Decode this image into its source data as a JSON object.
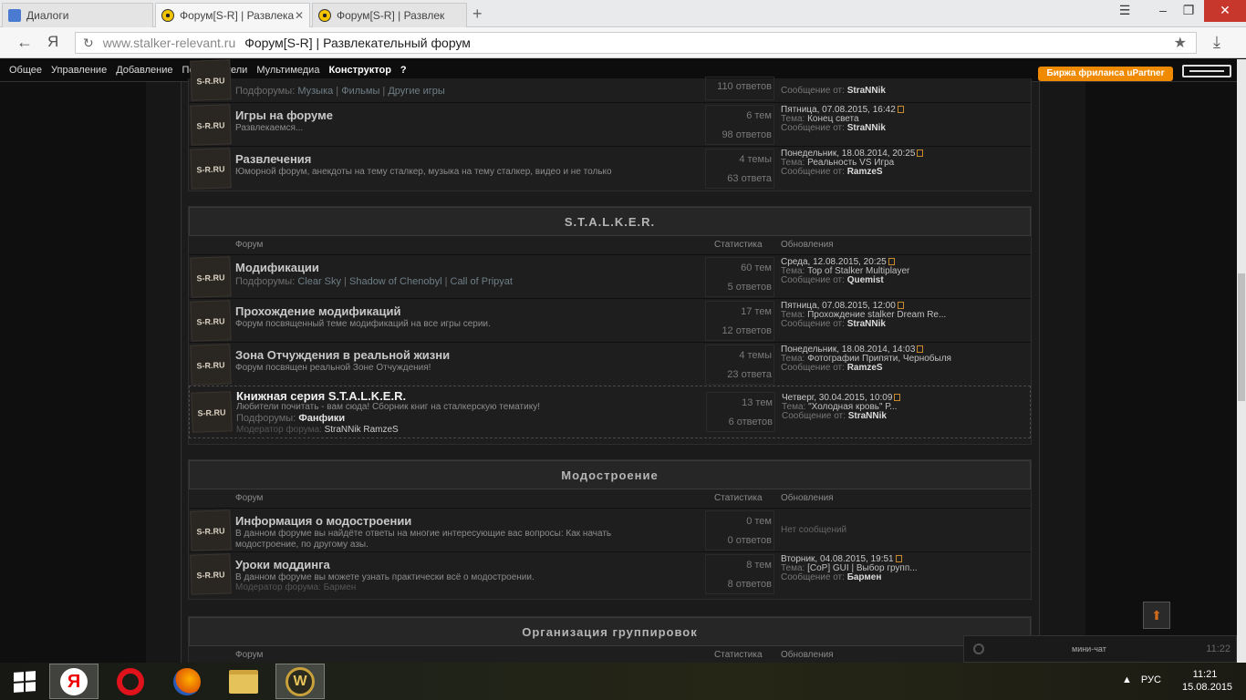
{
  "browser": {
    "tabs": [
      {
        "title": "Диалоги",
        "active": false
      },
      {
        "title": "Форум[S-R] | Развлека",
        "active": true
      },
      {
        "title": "Форум[S-R] | Развлек",
        "active": false
      }
    ],
    "url_host": "www.stalker-relevant.ru",
    "url_title": "Форум[S-R] | Развлекательный форум",
    "brand_letter": "Я"
  },
  "adminbar": {
    "items": [
      "Общее",
      "Управление",
      "Добавление",
      "Пользователи",
      "Мультимедиа",
      "Конструктор",
      "?"
    ],
    "freelance": "Биржа фриланса uPartner"
  },
  "forum_icon_text": "S-R.RU",
  "block1": {
    "rows": [
      {
        "title": "",
        "desc": "",
        "sub_label": "Подфорумы:",
        "subs": [
          "Музыка",
          "Фильмы",
          "Другие игры"
        ],
        "stat1": "",
        "stat2": "110 ответов",
        "date": "",
        "topic": "",
        "author": "StraNNik"
      },
      {
        "title": "Игры на форуме",
        "desc": "Развлекаемся...",
        "stat1": "6 тем",
        "stat2": "98 ответов",
        "date": "Пятница, 07.08.2015, 16:42",
        "topic": "Конец света",
        "author": "StraNNik"
      },
      {
        "title": "Развлечения",
        "desc": "Юморной форум, анекдоты на тему сталкер, музыка на тему сталкер, видео и не только",
        "stat1": "4 темы",
        "stat2": "63 ответа",
        "date": "Понедельник, 18.08.2014, 20:25",
        "topic": "Реальность VS Игра",
        "author": "RamzeS"
      }
    ]
  },
  "labels": {
    "col_forum": "Форум",
    "col_stats": "Статистика",
    "col_updates": "Обновления",
    "topic": "Тема:",
    "message_from": "Сообщение от:",
    "subforums": "Подфорумы:",
    "moderator": "Модератор форума:",
    "no_messages": "Нет сообщений"
  },
  "stalker": {
    "title": "S.T.A.L.K.E.R.",
    "rows": [
      {
        "title": "Модификации",
        "subs": [
          "Clear Sky",
          "Shadow of Chenobyl",
          "Call of Pripyat"
        ],
        "stat1": "60 тем",
        "stat2": "5 ответов",
        "date": "Среда, 12.08.2015, 20:25",
        "topic": "Top of Stalker Multiplayer",
        "author": "Quemist"
      },
      {
        "title": "Прохождение модификаций",
        "desc": "Форум посвященный теме модификаций на все игры серии.",
        "stat1": "17 тем",
        "stat2": "12 ответов",
        "date": "Пятница, 07.08.2015, 12:00",
        "topic": "Прохождение stalker Dream Re...",
        "author": "StraNNik"
      },
      {
        "title": "Зона Отчуждения в реальной жизни",
        "desc": "Форум посвящен реальной Зоне Отчуждения!",
        "stat1": "4 темы",
        "stat2": "23 ответа",
        "date": "Понедельник, 18.08.2014, 14:03",
        "topic": "Фотографии Припяти, Чернобыля",
        "author": "RamzeS"
      },
      {
        "title": "Книжная серия S.T.A.L.K.E.R.",
        "desc": "Любители почитать - вам сюда! Сборник книг на сталкерскую тематику!",
        "sub": "Фанфики",
        "moderators": "StraNNik  RamzeS",
        "stat1": "13 тем",
        "stat2": "6 ответов",
        "date": "Четверг, 30.04.2015, 10:09",
        "topic": "\"Холодная кровь\" Р...",
        "author": "StraNNik"
      }
    ]
  },
  "modding": {
    "title": "Модостроение",
    "rows": [
      {
        "title": "Информация о модостроении",
        "desc": "В данном форуме вы найдёте ответы на многие интересующие вас вопросы: Как начать модостроение, по другому азы.",
        "stat1": "0 тем",
        "stat2": "0 ответов"
      },
      {
        "title": "Уроки моддинга",
        "desc": "В данном форуме вы можете узнать практически всё о модостроении.",
        "moderator": "Бармен",
        "stat1": "8 тем",
        "stat2": "8 ответов",
        "date": "Вторник, 04.08.2015, 19:51",
        "topic": "[CoP] GUI | Выбор групп...",
        "author": "Бармен"
      }
    ]
  },
  "groups": {
    "title": "Организация группировок"
  },
  "minichat": {
    "label": "мини-чат",
    "time": "11:22"
  },
  "taskbar": {
    "lang": "РУС",
    "time": "11:21",
    "date": "15.08.2015",
    "wow_letter": "W"
  }
}
